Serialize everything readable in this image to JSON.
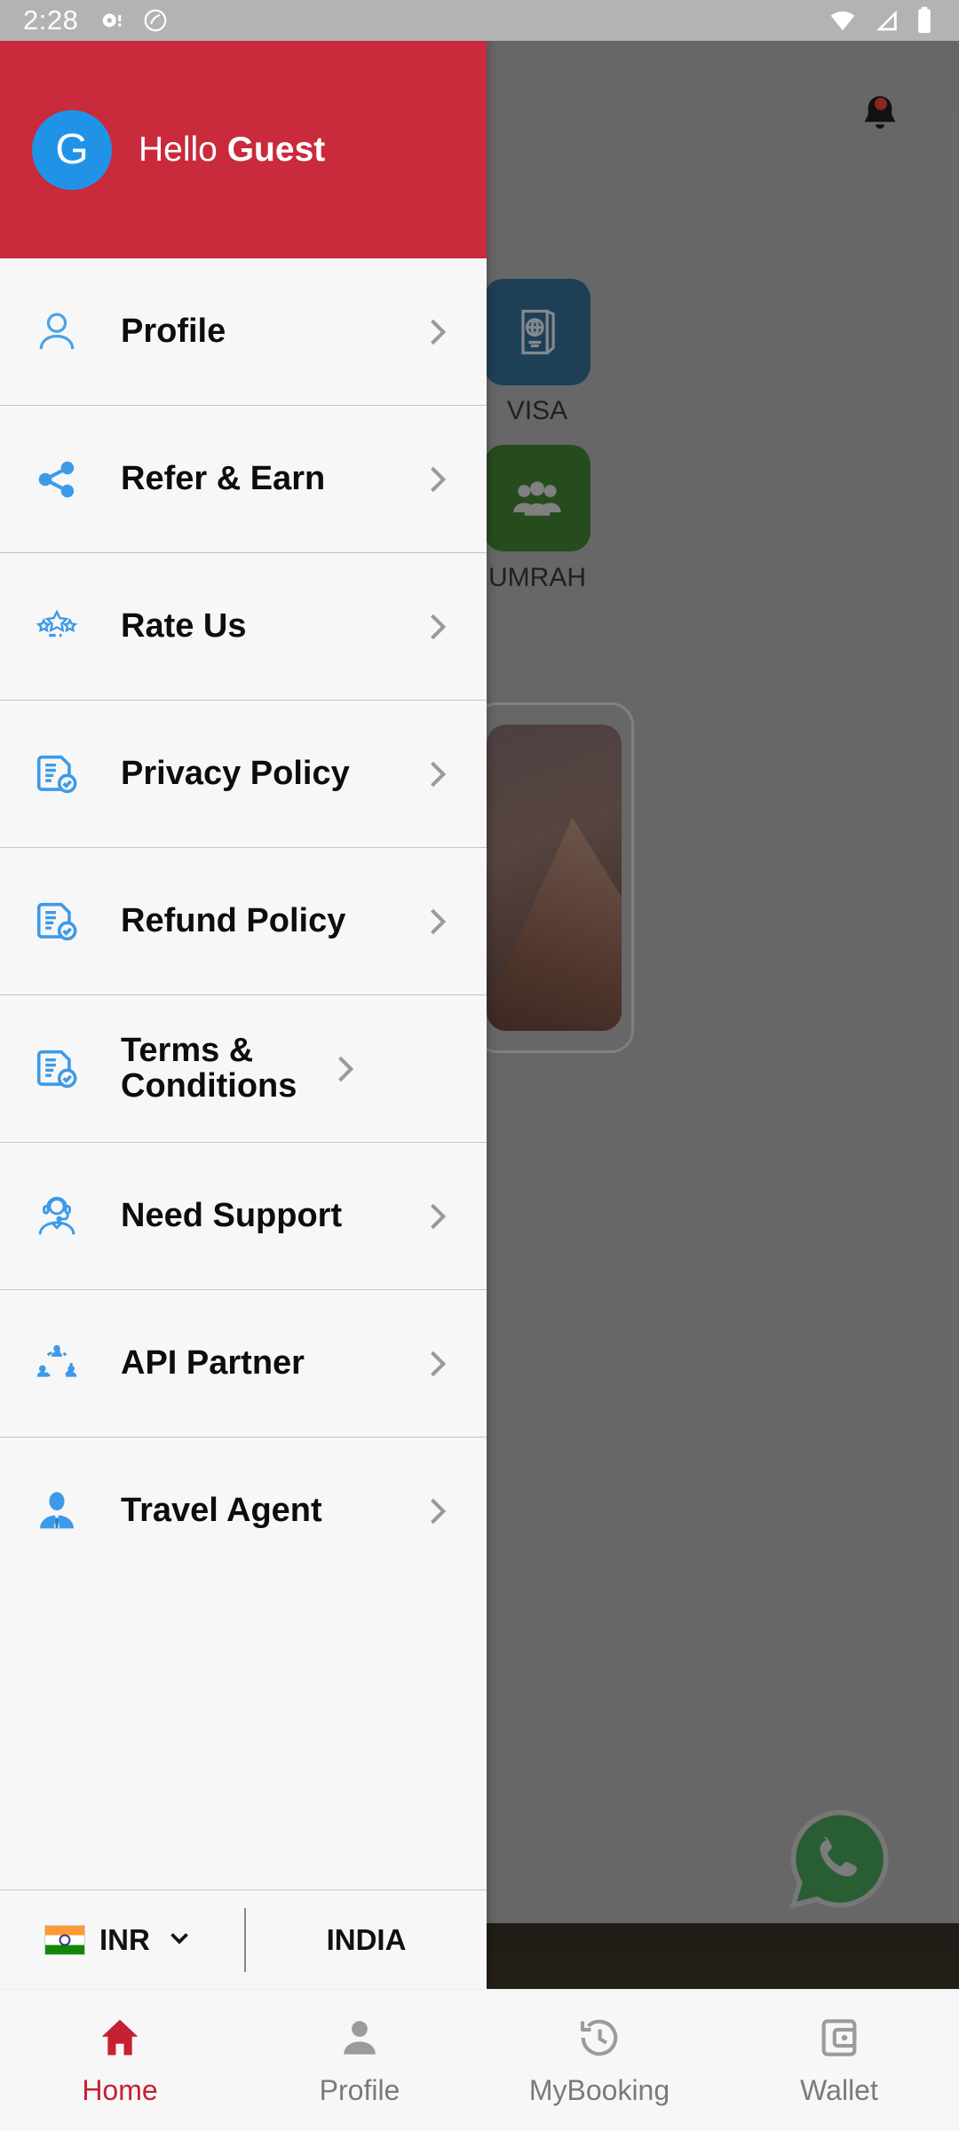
{
  "status_bar": {
    "time": "2:28",
    "left_icons": [
      "message-dot-icon",
      "do-not-disturb-icon"
    ],
    "right_icons": [
      "wifi-icon",
      "signal-icon",
      "battery-icon"
    ]
  },
  "background_app": {
    "bell_icon": "notification-bell-icon",
    "tiles": [
      {
        "label": "VISA",
        "color": "#17557f",
        "icon": "passport-icon"
      },
      {
        "label": "UMRAH",
        "color": "#256b17",
        "icon": "group-people-icon"
      }
    ],
    "fab": {
      "name": "whatsapp-fab",
      "color": "#25a244"
    }
  },
  "drawer": {
    "header": {
      "avatar_initial": "G",
      "avatar_color": "#2193e6",
      "background_color": "#c92a3c",
      "greeting_prefix": "Hello ",
      "greeting_name": "Guest"
    },
    "items": [
      {
        "label": "Profile",
        "icon": "user-outline-icon"
      },
      {
        "label": "Refer & Earn",
        "icon": "share-nodes-icon"
      },
      {
        "label": "Rate Us",
        "icon": "three-stars-icon"
      },
      {
        "label": "Privacy Policy",
        "icon": "document-check-icon"
      },
      {
        "label": "Refund Policy",
        "icon": "document-check-icon"
      },
      {
        "label": "Terms & Conditions",
        "icon": "document-check-icon"
      },
      {
        "label": "Need Support",
        "icon": "headset-agent-icon"
      },
      {
        "label": "API Partner",
        "icon": "people-network-icon"
      },
      {
        "label": "Travel Agent",
        "icon": "businessman-icon"
      }
    ],
    "chevron_icon": "chevron-right-icon",
    "footer": {
      "flag_icon": "india-flag-icon",
      "currency_code": "INR",
      "dropdown_icon": "chevron-down-icon",
      "country": "INDIA"
    }
  },
  "bottom_nav": {
    "active_color": "#c62033",
    "inactive_color": "#7a7a7a",
    "items": [
      {
        "label": "Home",
        "icon": "home-icon",
        "active": true
      },
      {
        "label": "Profile",
        "icon": "person-icon",
        "active": false
      },
      {
        "label": "MyBooking",
        "icon": "clock-history-icon",
        "active": false
      },
      {
        "label": "Wallet",
        "icon": "wallet-phone-icon",
        "active": false
      }
    ]
  }
}
